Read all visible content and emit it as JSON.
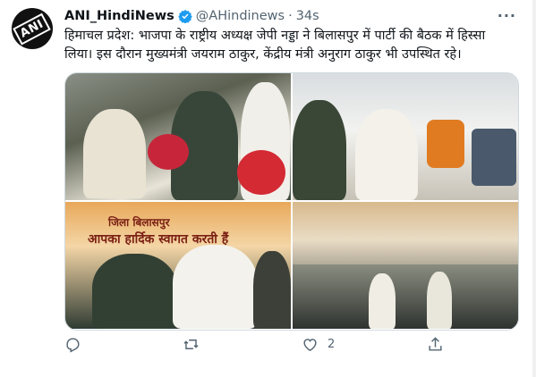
{
  "tweet": {
    "author_name": "ANI_HindiNews",
    "handle": "@AHindinews",
    "separator": "·",
    "time": "34s",
    "more_label": "···",
    "avatar_text": "ANI",
    "text": "हिमाचल प्रदेश: भाजपा के राष्ट्रीय अध्यक्ष जेपी नड्डा ने बिलासपुर में पार्टी की बैठक में हिस्सा लिया। इस दौरान मुख्यमंत्री जयराम ठाकुर, केंद्रीय मंत्री अनुराग ठाकुर भी उपस्थित रहे।"
  },
  "media": {
    "photo3_banner_line1": "जिला बिलासपुर",
    "photo3_banner_line2": "आपका हार्दिक स्वागत करती हैं"
  },
  "actions": {
    "reply_count": "",
    "retweet_count": "",
    "like_count": "2",
    "share_label": ""
  },
  "icons": {
    "verified": "verified-badge-icon",
    "reply": "reply-icon",
    "retweet": "retweet-icon",
    "like": "like-icon",
    "share": "share-icon"
  },
  "colors": {
    "verified": "#1d9bf0",
    "muted": "#536471",
    "text": "#0f1419"
  }
}
